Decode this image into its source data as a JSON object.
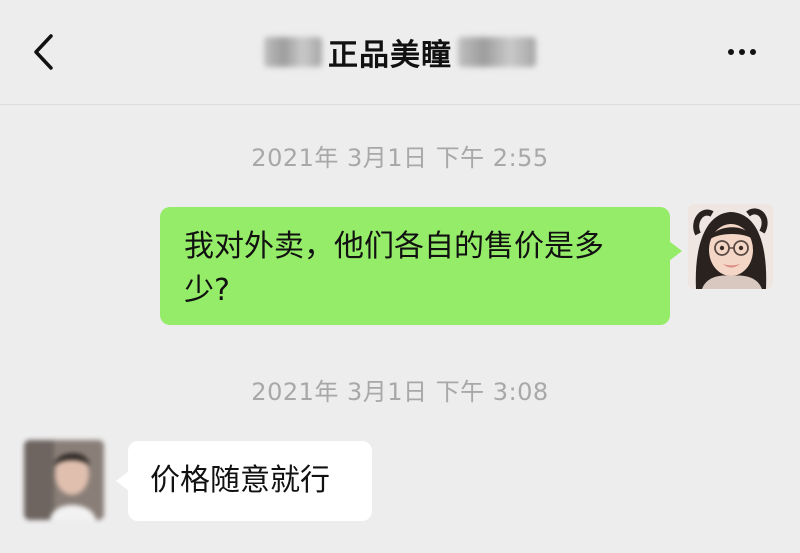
{
  "header": {
    "title": "正品美瞳",
    "back_icon": "chevron-left-icon",
    "more_icon": "more-horizontal-icon"
  },
  "messages": [
    {
      "timestamp": "2021年 3月1日 下午 2:55",
      "sender": "self",
      "text": "我对外卖，他们各自的售价是多少?"
    },
    {
      "timestamp": "2021年 3月1日 下午 3:08",
      "sender": "other",
      "text": "价格随意就行"
    }
  ],
  "colors": {
    "background": "#ededed",
    "self_bubble": "#95ec69",
    "other_bubble": "#ffffff",
    "timestamp": "#a8a8a8"
  }
}
